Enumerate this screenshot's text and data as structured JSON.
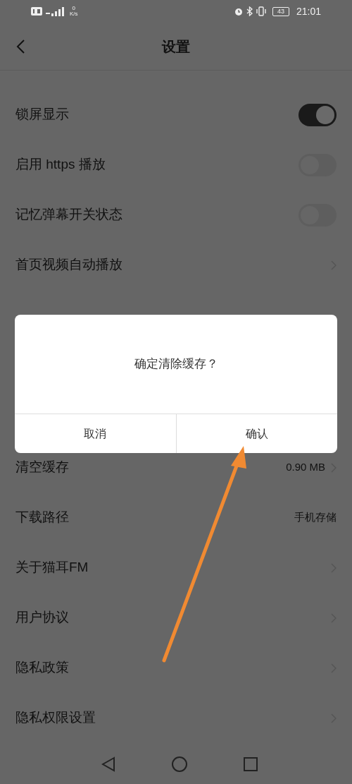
{
  "status_bar": {
    "net_speed": "0",
    "net_speed_unit": "K/s",
    "battery": "43",
    "time": "21:01"
  },
  "header": {
    "title": "设置"
  },
  "settings_top": [
    {
      "label": "锁屏显示",
      "kind": "toggle",
      "on": true
    },
    {
      "label": "启用 https 播放",
      "kind": "toggle",
      "on": false
    },
    {
      "label": "记忆弹幕开关状态",
      "kind": "toggle",
      "on": false
    },
    {
      "label": "首页视频自动播放",
      "kind": "link"
    }
  ],
  "settings_bottom": [
    {
      "label": "清空缓存",
      "kind": "link",
      "value": "0.90 MB"
    },
    {
      "label": "下载路径",
      "kind": "value",
      "value": "手机存储"
    },
    {
      "label": "关于猫耳FM",
      "kind": "link"
    },
    {
      "label": "用户协议",
      "kind": "link"
    },
    {
      "label": "隐私政策",
      "kind": "link"
    },
    {
      "label": "隐私权限设置",
      "kind": "link"
    }
  ],
  "dialog": {
    "message": "确定清除缓存？",
    "buttons": [
      "取消",
      "确认"
    ]
  }
}
